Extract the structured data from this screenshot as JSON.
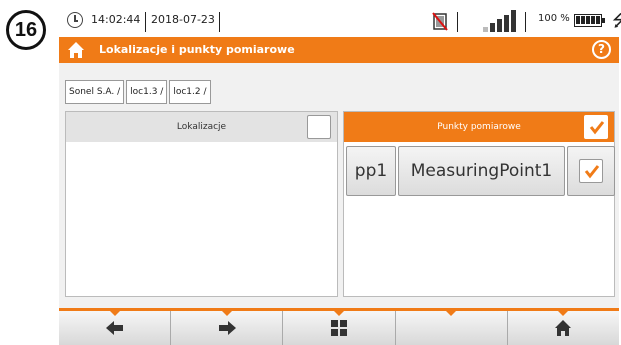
{
  "step_badge": "16",
  "status": {
    "time": "14:02:44",
    "date": "2018-07-23",
    "battery": "100 %"
  },
  "title_bar": {
    "title": "Lokalizacje i punkty pomiarowe",
    "home_icon": "home-icon",
    "help_icon": "help-icon",
    "help_glyph": "?"
  },
  "breadcrumb": [
    "Sonel S.A. /",
    "loc1.3 /",
    "loc1.2 /"
  ],
  "panels": {
    "left": {
      "header": "Lokalizacje",
      "checked": false
    },
    "right": {
      "header": "Punkty pomiarowe",
      "checked": true,
      "items": [
        {
          "id": "pp1",
          "name": "MeasuringPoint1",
          "checked": true
        }
      ]
    }
  },
  "bottom_nav": [
    {
      "icon": "arrow-left-icon"
    },
    {
      "icon": "arrow-right-icon"
    },
    {
      "icon": "grid-icon"
    },
    {
      "icon": ""
    },
    {
      "icon": "home-icon"
    }
  ],
  "colors": {
    "accent": "#f07b17",
    "check": "#f07b17"
  }
}
